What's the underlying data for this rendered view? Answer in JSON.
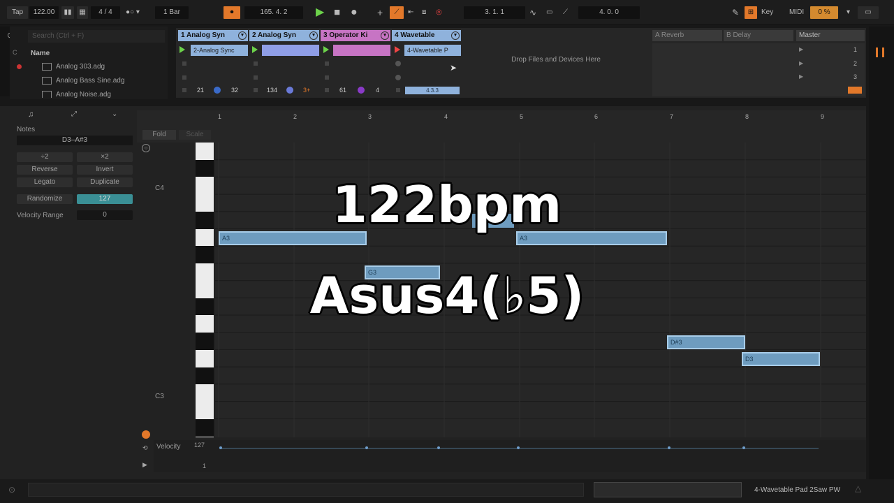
{
  "transport": {
    "tap": "Tap",
    "bpm": "122.00",
    "meter": "4 / 4",
    "quantize": "1 Bar",
    "position": "165.  4.  2",
    "loop_start": "3.  1.  1",
    "loop_length": "4.  0.  0",
    "key": "Key",
    "midi": "MIDI",
    "cpu": "0 %"
  },
  "browser": {
    "search": "Search (Ctrl + F)",
    "header": "Name",
    "items": [
      "Analog 303.adg",
      "Analog Bass Sine.adg",
      "Analog Noise.adg"
    ]
  },
  "tracks": [
    {
      "name": "1 Analog Syn",
      "color": "#8fb2dc",
      "clip": "2-Analog Sync",
      "clip_color": "#8fb2dc",
      "vol": "21",
      "pan": "32"
    },
    {
      "name": "2 Analog Syn",
      "color": "#8fb2dc",
      "clip": "",
      "clip_color": "#8f9ee6",
      "vol": "134",
      "pan": ""
    },
    {
      "name": "3 Operator Ki",
      "color": "#c774c4",
      "clip": "",
      "clip_color": "#c774c4",
      "vol": "61",
      "pan": "4"
    },
    {
      "name": "4 Wavetable",
      "color": "#8fb2dc",
      "clip": "4-Wavetable P",
      "clip_color": "#8fb2dc",
      "vol": "4.3.3",
      "pan": ""
    }
  ],
  "drop_text": "Drop Files and Devices Here",
  "returns": [
    "A Reverb",
    "B Delay"
  ],
  "master": {
    "name": "Master",
    "scenes": [
      "1",
      "2",
      "3"
    ]
  },
  "notes_panel": {
    "title": "Notes",
    "range": "D3–A#3",
    "buttons": [
      "÷2",
      "×2",
      "Reverse",
      "Invert",
      "Legato",
      "Duplicate"
    ],
    "randomize": "Randomize",
    "randomize_val": "127",
    "velocity_range": "Velocity Range",
    "velocity_range_val": "0"
  },
  "clip_toolbar": {
    "fold": "Fold",
    "scale": "Scale"
  },
  "ruler": [
    "1",
    "2",
    "3",
    "4",
    "5",
    "6",
    "7",
    "8",
    "9"
  ],
  "piano_labels": {
    "c4": "C4",
    "c3": "C3"
  },
  "notes": [
    {
      "label": "A3"
    },
    {
      "label": "G3"
    },
    {
      "label": "A3"
    },
    {
      "label": "D#3"
    },
    {
      "label": "D3"
    }
  ],
  "velocity": {
    "label": "Velocity",
    "max": "127",
    "min": "1"
  },
  "overlay": {
    "bpm": "122bpm",
    "chord": "Asus4(♭5)"
  },
  "status": {
    "device": "4-Wavetable Pad 2Saw PW"
  }
}
